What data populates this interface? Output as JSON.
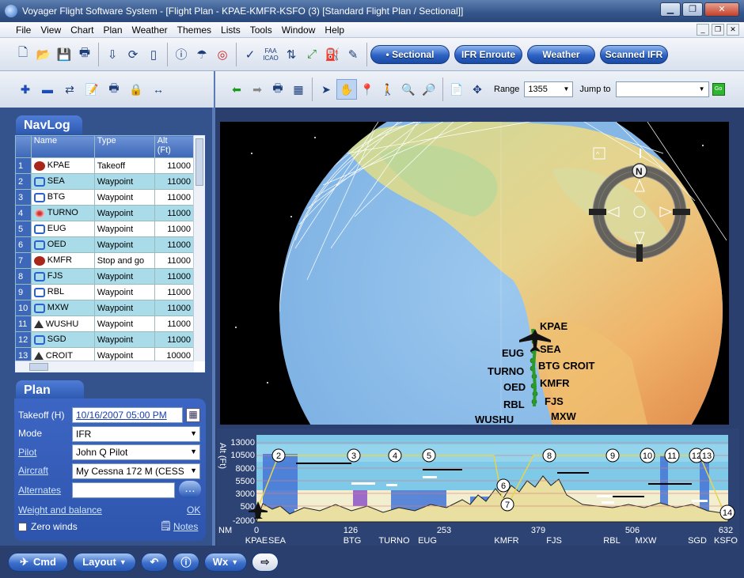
{
  "window": {
    "title": "Voyager Flight Software System - [Flight Plan - KPAE-KMFR-KSFO (3) [Standard Flight Plan / Sectional]]"
  },
  "menu": [
    {
      "label": "File"
    },
    {
      "label": "View"
    },
    {
      "label": "Chart"
    },
    {
      "label": "Plan"
    },
    {
      "label": "Weather"
    },
    {
      "label": "Themes"
    },
    {
      "label": "Lists"
    },
    {
      "label": "Tools"
    },
    {
      "label": "Window"
    },
    {
      "label": "Help"
    }
  ],
  "chart_tabs": [
    {
      "label": "• Sectional"
    },
    {
      "label": "IFR Enroute"
    },
    {
      "label": "Weather"
    },
    {
      "label": "Scanned IFR"
    }
  ],
  "map_toolbar": {
    "range_label": "Range",
    "range_value": "1355",
    "jump_label": "Jump to",
    "jump_value": "",
    "go_label": "Go"
  },
  "navlog": {
    "title": "NavLog",
    "headers": {
      "name": "Name",
      "type": "Type",
      "alt": "Alt\n(Ft)"
    },
    "rows": [
      {
        "num": "1",
        "name": "KPAE",
        "type": "Takeoff",
        "alt": "11000",
        "icon": "airport-icon"
      },
      {
        "num": "2",
        "name": "SEA",
        "type": "Waypoint",
        "alt": "11000",
        "icon": "vor-icon"
      },
      {
        "num": "3",
        "name": "BTG",
        "type": "Waypoint",
        "alt": "11000",
        "icon": "vor-icon"
      },
      {
        "num": "4",
        "name": "TURNO",
        "type": "Waypoint",
        "alt": "11000",
        "icon": "ndb-icon"
      },
      {
        "num": "5",
        "name": "EUG",
        "type": "Waypoint",
        "alt": "11000",
        "icon": "vor-icon"
      },
      {
        "num": "6",
        "name": "OED",
        "type": "Waypoint",
        "alt": "11000",
        "icon": "vor-icon"
      },
      {
        "num": "7",
        "name": "KMFR",
        "type": "Stop and go",
        "alt": "11000",
        "icon": "airport-icon"
      },
      {
        "num": "8",
        "name": "FJS",
        "type": "Waypoint",
        "alt": "11000",
        "icon": "vor-icon"
      },
      {
        "num": "9",
        "name": "RBL",
        "type": "Waypoint",
        "alt": "11000",
        "icon": "vor-icon"
      },
      {
        "num": "10",
        "name": "MXW",
        "type": "Waypoint",
        "alt": "11000",
        "icon": "vor-icon"
      },
      {
        "num": "11",
        "name": "WUSHU",
        "type": "Waypoint",
        "alt": "11000",
        "icon": "fix-icon"
      },
      {
        "num": "12",
        "name": "SGD",
        "type": "Waypoint",
        "alt": "11000",
        "icon": "vor-icon"
      },
      {
        "num": "13",
        "name": "CROIT",
        "type": "Waypoint",
        "alt": "10000",
        "icon": "fix-icon"
      }
    ]
  },
  "plan": {
    "title": "Plan",
    "takeoff_label": "Takeoff (H)",
    "takeoff_value": "10/16/2007 05:00 PM",
    "mode_label": "Mode",
    "mode_value": "IFR",
    "pilot_label": "Pilot",
    "pilot_value": "John Q Pilot",
    "aircraft_label": "Aircraft",
    "aircraft_value": "My Cessna 172 M (CESS",
    "alternates_label": "Alternates",
    "wb_label": "Weight and balance",
    "wb_ok": "OK",
    "zero_winds_label": "Zero winds",
    "notes_label": "Notes"
  },
  "map_labels": [
    {
      "text": "KPAE"
    },
    {
      "text": "SEA"
    },
    {
      "text": "EUG"
    },
    {
      "text": "BTG"
    },
    {
      "text": "CROIT"
    },
    {
      "text": "TURNO"
    },
    {
      "text": "KMFR"
    },
    {
      "text": "OED"
    },
    {
      "text": "FJS"
    },
    {
      "text": "RBL"
    },
    {
      "text": "MXW"
    },
    {
      "text": "WUSHU"
    }
  ],
  "compass": {
    "north": "N"
  },
  "profile": {
    "ylabel": "Alt (Ft)",
    "yticks": [
      "13000",
      "10500",
      "8000",
      "5500",
      "3000",
      "500",
      "-2000"
    ],
    "xunit": "NM",
    "xticks": [
      "0",
      "126",
      "253",
      "379",
      "506",
      "632"
    ],
    "waypoints_bottom": [
      "KPAE",
      "SEA",
      "BTG",
      "TURNO",
      "EUG",
      "KMFR",
      "FJS",
      "RBL",
      "MXW",
      "SGD",
      "KSFO"
    ],
    "markers": [
      "2",
      "3",
      "4",
      "5",
      "6",
      "7",
      "8",
      "9",
      "10",
      "11",
      "12",
      "13",
      "14"
    ]
  },
  "bottom": {
    "cmd": "Cmd",
    "layout": "Layout",
    "wx": "Wx"
  }
}
